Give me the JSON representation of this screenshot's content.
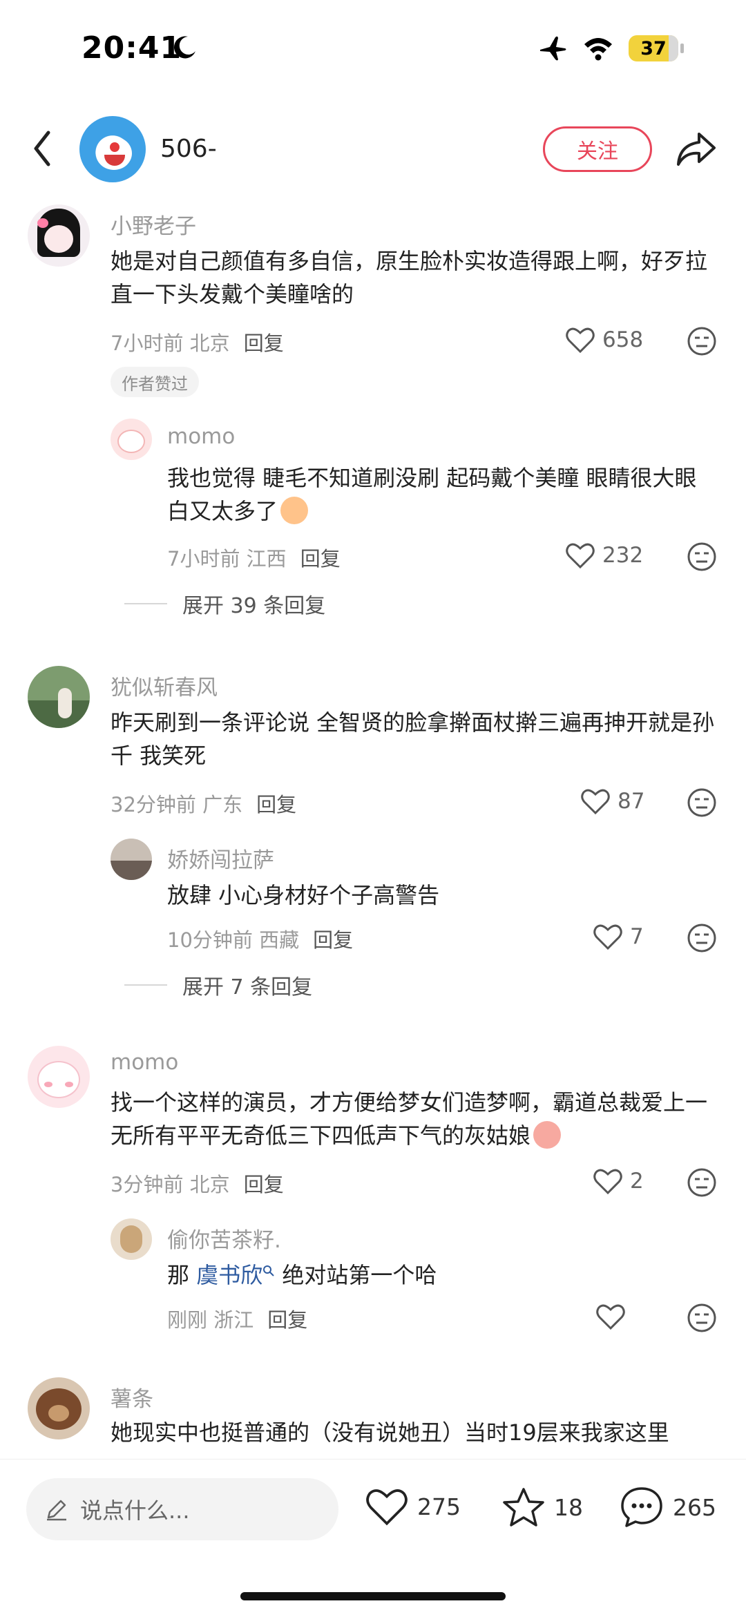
{
  "status_bar": {
    "time": "20:41",
    "battery": "37"
  },
  "header": {
    "username": "506-",
    "follow_label": "关注"
  },
  "comments": [
    {
      "user": "小野老子",
      "text": "她是对自己颜值有多自信，原生脸朴实妆造得跟上啊，好歹拉直一下头发戴个美瞳啥的",
      "time": "7小时前",
      "location": "北京",
      "reply_label": "回复",
      "likes": "658",
      "badge": "作者赞过",
      "replies": [
        {
          "user": "momo",
          "text": "我也觉得 睫毛不知道刷没刷 起码戴个美瞳 眼睛很大眼白又太多了",
          "time": "7小时前",
          "location": "江西",
          "reply_label": "回复",
          "likes": "232"
        }
      ],
      "expand_label": "展开 39 条回复"
    },
    {
      "user": "犹似斩春风",
      "text": "昨天刷到一条评论说 全智贤的脸拿擀面杖擀三遍再抻开就是孙千 我笑死",
      "time": "32分钟前",
      "location": "广东",
      "reply_label": "回复",
      "likes": "87",
      "replies": [
        {
          "user": "娇娇闯拉萨",
          "text": "放肆 小心身材好个子高警告",
          "time": "10分钟前",
          "location": "西藏",
          "reply_label": "回复",
          "likes": "7"
        }
      ],
      "expand_label": "展开 7 条回复"
    },
    {
      "user": "momo",
      "text": "找一个这样的演员，才方便给梦女们造梦啊，霸道总裁爱上一无所有平平无奇低三下四低声下气的灰姑娘",
      "time": "3分钟前",
      "location": "北京",
      "reply_label": "回复",
      "likes": "2",
      "replies": [
        {
          "user": "偷你苦茶籽.",
          "text_prefix": "那 ",
          "mention": "虞书欣",
          "text_suffix": " 绝对站第一个哈",
          "time": "刚刚",
          "location": "浙江",
          "reply_label": "回复",
          "likes": ""
        }
      ]
    },
    {
      "user": "薯条",
      "text": "她现实中也挺普通的（没有说她丑）当时19层来我家这里"
    }
  ],
  "bottom_bar": {
    "input_placeholder": "说点什么...",
    "likes": "275",
    "stars": "18",
    "comments": "265"
  },
  "colors": {
    "accent": "#e8465a",
    "mention": "#2e5ba0",
    "muted": "#9a9a9a"
  }
}
